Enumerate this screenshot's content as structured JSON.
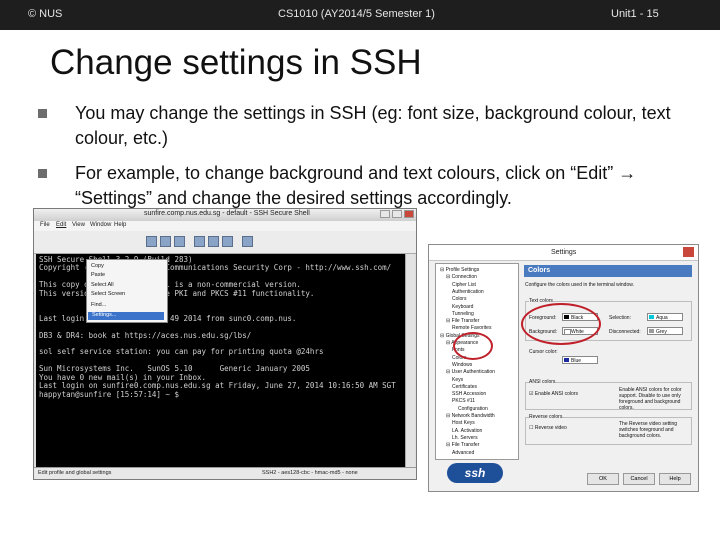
{
  "header": {
    "left": "© NUS",
    "center": "CS1010 (AY2014/5 Semester 1)",
    "right": "Unit1 - 15"
  },
  "slide": {
    "title": "Change settings in SSH",
    "bullets": [
      "You may change the settings in SSH (eg: font size, background colour, text colour, etc.)",
      "For example, to change background and text colours, click on “Edit” → “Settings” and change the desired settings accordingly."
    ]
  },
  "ssh_window": {
    "title": "sunfire.comp.nus.edu.sg - default - SSH Secure Shell",
    "menu": [
      "File",
      "Edit",
      "View",
      "Window",
      "Help"
    ],
    "edit_menu": [
      "Copy",
      "Paste",
      "Select All",
      "Select Screen",
      "Find...",
      "Settings..."
    ],
    "terminal_lines": [
      "SSH Secure Shell 3.2.9 (Build 283)",
      "Copyright (c) 2000-2003 SSH Communications Security Corp - http://www.ssh.com/",
      "",
      "This copy of SSH Secure Shell is a non-commercial version.",
      "This version does not include PKI and PKCS #11 functionality.",
      "",
      "",
      "Last login: Fri Jan 27 10:11:49 2014 from sunc0.comp.nus.",
      "",
      "DB3 & DR4: book at https://aces.nus.edu.sg/lbs/",
      "",
      "sol self service station: you can pay for printing quota @24hrs",
      "",
      "Sun Microsystems Inc.   SunOS 5.10      Generic January 2005",
      "You have 0 new mail(s) in your Inbox.",
      "Last login on sunfire0.comp.nus.edu.sg at Friday, June 27, 2014 10:16:50 AM SGT",
      "happytan@sunfire [15:57:14] ~ $"
    ],
    "status": [
      "Edit profile and global settings",
      "SSH2 - aes128-cbc - hmac-md5 - none"
    ]
  },
  "settings_dialog": {
    "title": "Settings",
    "tree": [
      "Profile Settings",
      "Connection",
      "Cipher List",
      "Authentication",
      "Colors",
      "Keyboard",
      "Tunneling",
      "File Transfer",
      "Remote Favorites",
      "Global Settings",
      "Appearance",
      "Fonts",
      "Colors",
      "Windows",
      "User Authentication",
      "Keys",
      "Certificates",
      "SSH Accession",
      "PKCS #11",
      "Configuration",
      "Network Bandwidth",
      "Host Keys",
      "LA. Activation",
      "Lh. Servers",
      "File Transfer",
      "Advanced"
    ],
    "panel_title": "Colors",
    "panel_desc": "Configure the colors used in the terminal window.",
    "group_text": "Text colors",
    "foreground_label": "Foreground:",
    "foreground_value": "Black",
    "background_label": "Background:",
    "background_value": "White",
    "selection_label": "Selection:",
    "selection_value": "Aqua",
    "disconnected_label": "Disconnected:",
    "disconnected_value": "Grey",
    "cursor_label": "Cursor color:",
    "cursor_value": "Blue",
    "ansi_group": "ANSI colors",
    "ansi_check": "Enable ANSI colors",
    "ansi_desc": "Enable ANSI colors for color support. Disable to use only foreground and background colors.",
    "reverse_group": "Reverse colors",
    "reverse_check": "Reverse video",
    "reverse_desc": "The Reverse video setting switches foreground and background colors.",
    "buttons": [
      "OK",
      "Cancel",
      "Help"
    ],
    "logo": "ssh",
    "colors": {
      "black": "#000000",
      "white": "#ffffff",
      "aqua": "#00c8d8",
      "grey": "#9a9a9a",
      "blue": "#1a2aa0"
    }
  }
}
